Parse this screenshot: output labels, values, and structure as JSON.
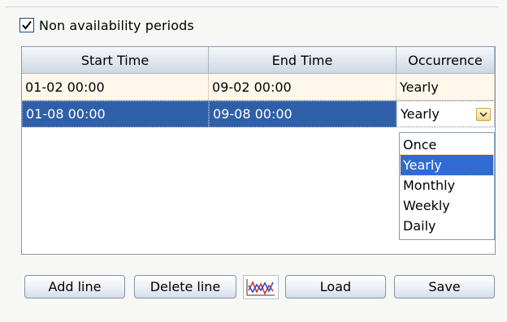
{
  "non_availability": {
    "checkbox_label": "Non availability periods",
    "checked": true
  },
  "table": {
    "columns": [
      "Start Time",
      "End Time",
      "Occurrence"
    ],
    "rows": [
      {
        "start": "01-02 00:00",
        "end": "09-02 00:00",
        "occurrence": "Yearly"
      },
      {
        "start": "01-08 00:00",
        "end": "09-08 00:00",
        "occurrence": "Yearly",
        "selected": true
      }
    ]
  },
  "occurrence_dropdown": {
    "options": [
      "Once",
      "Yearly",
      "Monthly",
      "Weekly",
      "Daily"
    ],
    "selected": "Yearly"
  },
  "buttons": {
    "add_line": "Add line",
    "delete_line": "Delete line",
    "chart_icon": "line-chart-icon",
    "load": "Load",
    "save": "Save"
  },
  "colors": {
    "selection_blue": "#2f5fa8",
    "row_cream": "#fef8ec",
    "dropdown_highlight": "#2f6bd3"
  }
}
